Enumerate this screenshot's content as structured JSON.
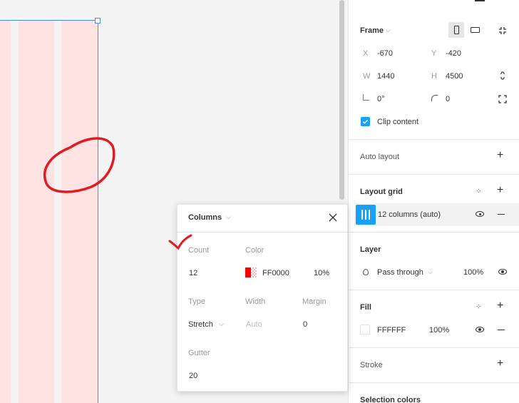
{
  "canvas": {},
  "frame_section": {
    "title": "Frame",
    "x_label": "X",
    "x_value": "-670",
    "y_label": "Y",
    "y_value": "-420",
    "w_label": "W",
    "w_value": "1440",
    "h_label": "H",
    "h_value": "4500",
    "rotation_value": "0°",
    "radius_value": "0",
    "clip_content_label": "Clip content",
    "clip_content_checked": true
  },
  "auto_layout": {
    "title": "Auto layout"
  },
  "layout_grid": {
    "title": "Layout grid",
    "item_label": "12 columns (auto)"
  },
  "layer": {
    "title": "Layer",
    "blend_mode": "Pass through",
    "opacity": "100%"
  },
  "fill": {
    "title": "Fill",
    "hex": "FFFFFF",
    "opacity": "100%"
  },
  "stroke": {
    "title": "Stroke"
  },
  "selection_colors": {
    "title": "Selection colors"
  },
  "popup": {
    "title": "Columns",
    "count_label": "Count",
    "count_value": "12",
    "color_label": "Color",
    "color_hex": "FF0000",
    "color_opacity": "10%",
    "type_label": "Type",
    "type_value": "Stretch",
    "width_label": "Width",
    "width_placeholder": "Auto",
    "margin_label": "Margin",
    "margin_value": "0",
    "gutter_label": "Gutter",
    "gutter_value": "20"
  },
  "colors": {
    "accent": "#18a0fb",
    "grid_column": "#ffe3e3",
    "selection": "#4a90e2",
    "annotation_red": "#e01b24"
  }
}
